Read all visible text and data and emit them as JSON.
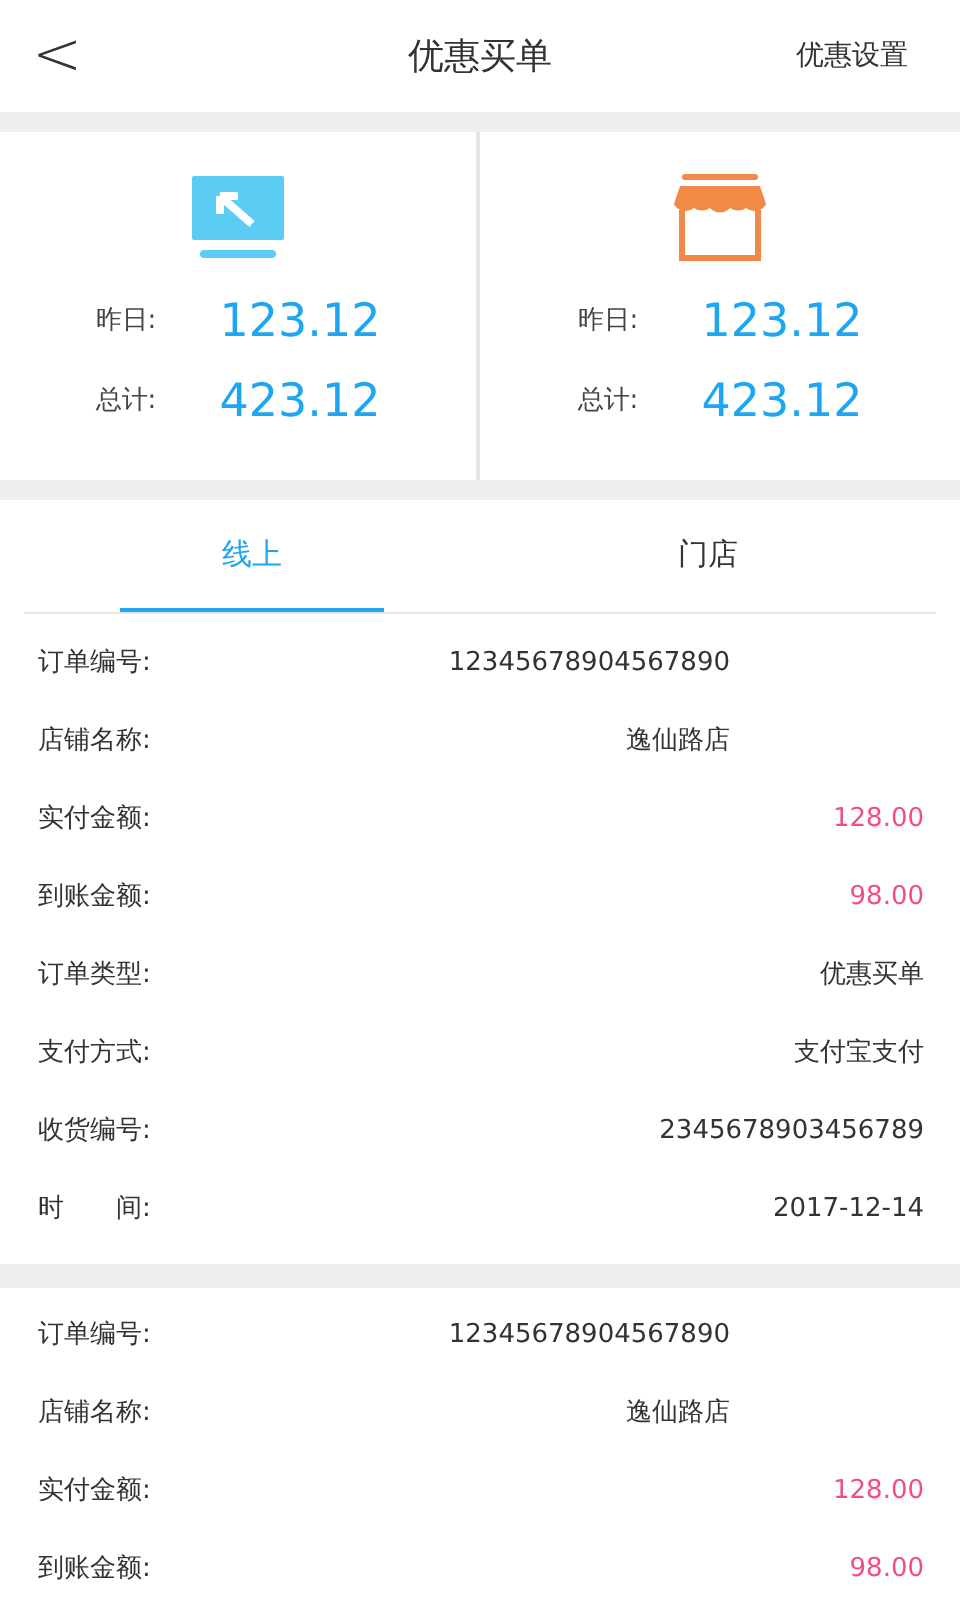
{
  "header": {
    "back": "<",
    "title": "优惠买单",
    "action": "优惠设置"
  },
  "stats": [
    {
      "kind": "online",
      "rows": [
        {
          "label": "昨日:",
          "value": "123.12"
        },
        {
          "label": "总计:",
          "value": "423.12"
        }
      ]
    },
    {
      "kind": "store",
      "rows": [
        {
          "label": "昨日:",
          "value": "123.12"
        },
        {
          "label": "总计:",
          "value": "423.12"
        }
      ]
    }
  ],
  "tabs": [
    {
      "label": "线上",
      "selected": true
    },
    {
      "label": "门店",
      "selected": false
    }
  ],
  "orders": [
    {
      "fields": [
        {
          "label": "订单编号:",
          "value": "12345678904567890",
          "kind": "narrow"
        },
        {
          "label": "店铺名称:",
          "value": "逸仙路店",
          "kind": "narrow"
        },
        {
          "label": "实付金额:",
          "value": "128.00",
          "kind": "money"
        },
        {
          "label": "到账金额:",
          "value": "98.00",
          "kind": "money"
        },
        {
          "label": "订单类型:",
          "value": "优惠买单",
          "kind": "plain"
        },
        {
          "label": "支付方式:",
          "value": "支付宝支付",
          "kind": "plain"
        },
        {
          "label": "收货编号:",
          "value": "2345678903456789",
          "kind": "plain"
        },
        {
          "label": "时　　间:",
          "value": "2017-12-14",
          "kind": "plain"
        }
      ]
    },
    {
      "fields": [
        {
          "label": "订单编号:",
          "value": "12345678904567890",
          "kind": "narrow"
        },
        {
          "label": "店铺名称:",
          "value": "逸仙路店",
          "kind": "narrow"
        },
        {
          "label": "实付金额:",
          "value": "128.00",
          "kind": "money"
        },
        {
          "label": "到账金额:",
          "value": "98.00",
          "kind": "money"
        }
      ]
    }
  ]
}
